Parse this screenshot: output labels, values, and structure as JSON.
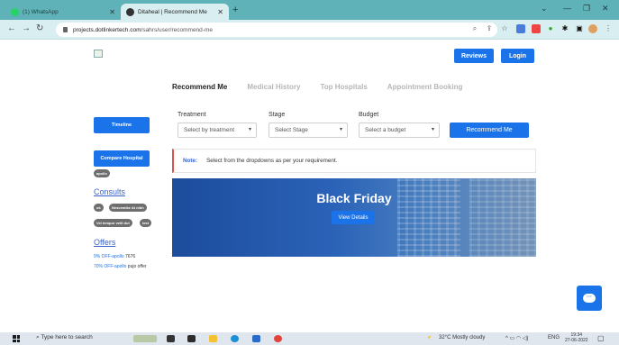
{
  "browser": {
    "tabs": [
      {
        "title": "(1) WhatsApp",
        "active": false
      },
      {
        "title": "Ditaheal | Recommend Me",
        "active": true
      }
    ],
    "url_host": "projects.dotlinkertech.com",
    "url_path": "/sahrs/user/recommend-me"
  },
  "header": {
    "reviews_label": "Reviews",
    "login_label": "Login"
  },
  "nav": {
    "tabs": [
      "Recommend Me",
      "Medical History",
      "Top Hospitals",
      "Appointment Booking"
    ],
    "active_index": 0
  },
  "sidebar": {
    "timeline_label": "Timeline",
    "compare_label": "Compare Hospital",
    "compare_chip": "apollo",
    "consults_heading": "Consults",
    "consult_chips": [
      "ok",
      "Nescemike At nibh",
      "Vel tempor velit dol",
      "test"
    ],
    "offers_heading": "Offers",
    "offers": [
      {
        "link": "9% OFF-apollo",
        "text": "7676"
      },
      {
        "link": "70% OFF-apollo",
        "text": "pujo offer"
      }
    ]
  },
  "filters": {
    "treatment_label": "Treatment",
    "treatment_placeholder": "Select by treatment",
    "stage_label": "Stage",
    "stage_placeholder": "Select Stage",
    "budget_label": "Budget",
    "budget_placeholder": "Select a budget",
    "recommend_label": "Recommend Me"
  },
  "note": {
    "label": "Note:",
    "text": "Select from the dropdowns as per your requirement."
  },
  "banner": {
    "title": "Black Friday",
    "button_label": "View Details"
  },
  "taskbar": {
    "search_placeholder": "Type here to search",
    "weather": "32°C  Mostly cloudy",
    "lang": "ENG",
    "time": "19:34",
    "date": "27-06-2022"
  },
  "colors": {
    "accent": "#1a73e8",
    "tabstrip": "#5fb3b8",
    "note_border": "#d9534f"
  }
}
